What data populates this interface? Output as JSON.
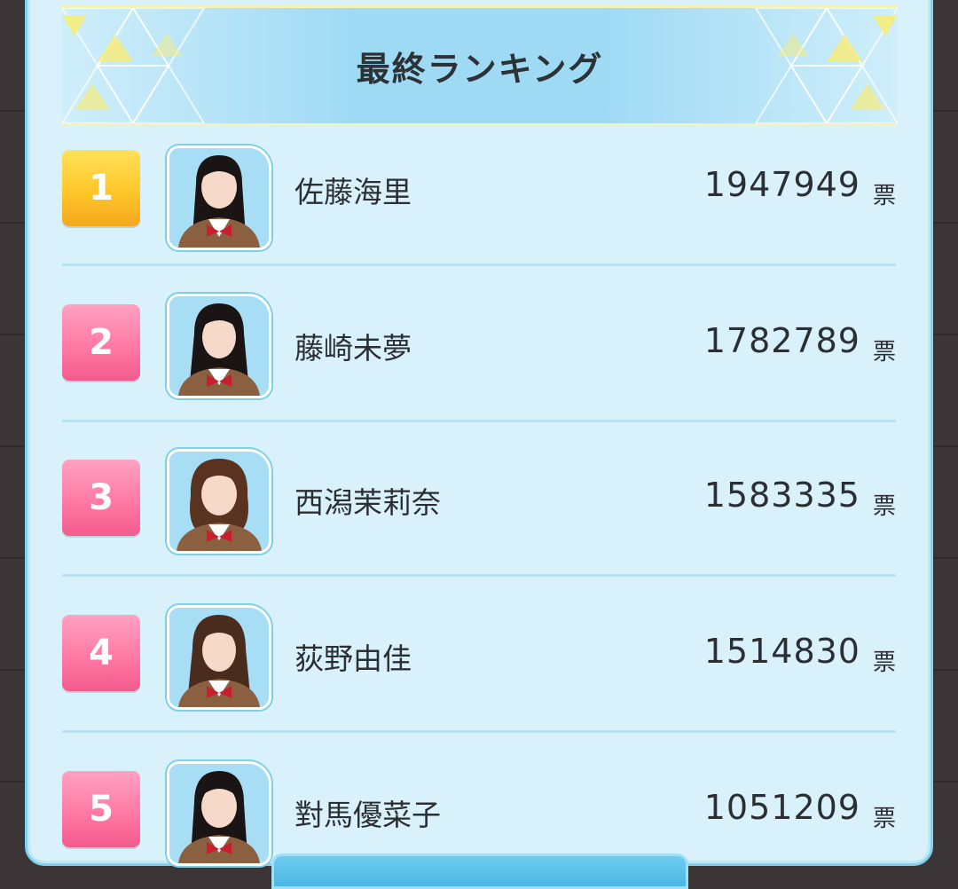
{
  "header": {
    "title": "最終ランキング"
  },
  "colors": {
    "panel": "#d8f1fb",
    "gold": "#ffc62a",
    "pink": "#ff7aa5",
    "header": "#9fdaf4"
  },
  "rankings": [
    {
      "rank": "1",
      "name": "佐藤海里",
      "votes": "1947949",
      "unit": "票",
      "badge": "gold",
      "hair": "#1a1414"
    },
    {
      "rank": "2",
      "name": "藤崎未夢",
      "votes": "1782789",
      "unit": "票",
      "badge": "pink",
      "hair": "#1a1414"
    },
    {
      "rank": "3",
      "name": "西潟茉莉奈",
      "votes": "1583335",
      "unit": "票",
      "badge": "pink",
      "hair": "#5a3320"
    },
    {
      "rank": "4",
      "name": "荻野由佳",
      "votes": "1514830",
      "unit": "票",
      "badge": "pink",
      "hair": "#4a2c1e"
    },
    {
      "rank": "5",
      "name": "對馬優菜子",
      "votes": "1051209",
      "unit": "票",
      "badge": "pink",
      "hair": "#1a1414"
    }
  ]
}
